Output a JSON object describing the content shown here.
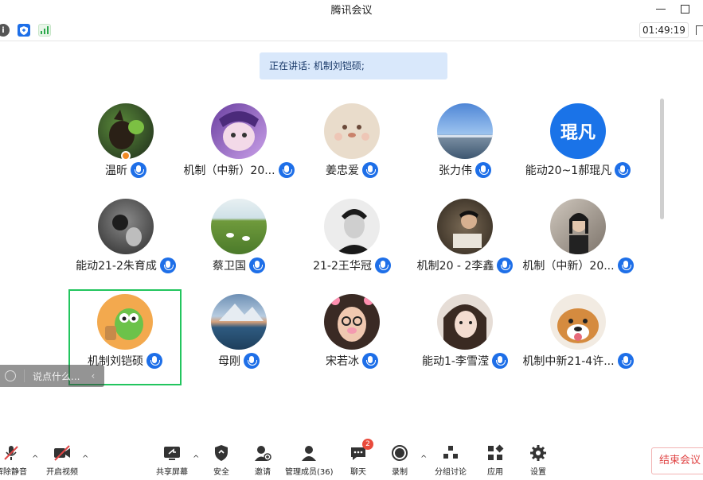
{
  "window": {
    "title": "腾讯会议"
  },
  "infobar": {
    "timer": "01:49:19"
  },
  "speaking_banner": "正在讲话: 机制刘铠硕;",
  "participants": [
    {
      "name": "温昕"
    },
    {
      "name": "机制（中新）20..."
    },
    {
      "name": "姜忠爱"
    },
    {
      "name": "张力伟"
    },
    {
      "name": "能动20~1郝琨凡",
      "avatar_text": "琨凡"
    },
    {
      "name": "能动21-2朱育成"
    },
    {
      "name": "蔡卫国"
    },
    {
      "name": "21-2王华冠"
    },
    {
      "name": "机制20 - 2李鑫"
    },
    {
      "name": "机制（中新）20..."
    },
    {
      "name": "机制刘铠硕"
    },
    {
      "name": "母刚"
    },
    {
      "name": "宋若冰"
    },
    {
      "name": "能动1-李雪滢"
    },
    {
      "name": "机制中新21-4许..."
    }
  ],
  "chat_mini": {
    "placeholder": "说点什么..."
  },
  "toolbar": {
    "unmute": "解除静音",
    "video": "开启视频",
    "share": "共享屏幕",
    "security": "安全",
    "invite": "邀请",
    "members": "管理成员(36)",
    "chat": "聊天",
    "chat_badge": "2",
    "record": "录制",
    "breakout": "分组讨论",
    "apps": "应用",
    "settings": "设置",
    "end": "结束会议"
  },
  "colors": {
    "accent": "#1e6fe8",
    "active_border": "#22c55e",
    "end_red": "#e04646"
  }
}
